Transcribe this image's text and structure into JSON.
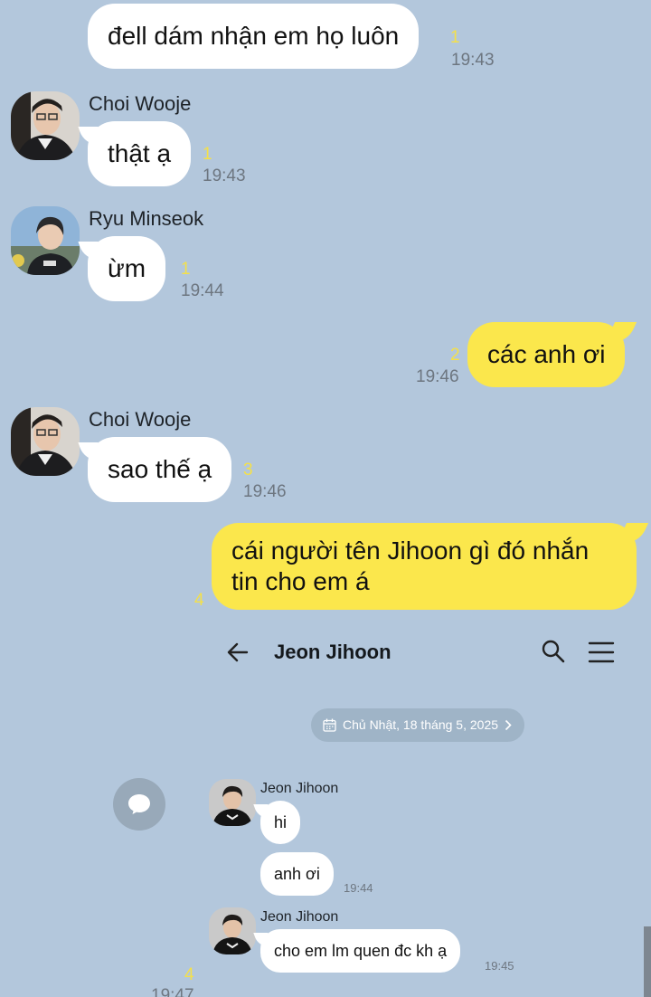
{
  "colors": {
    "background": "#b3c7dc",
    "my_bubble": "#fbe74c",
    "their_bubble": "#ffffff",
    "unread_count": "#f4e04a",
    "timestamp": "#6d7680"
  },
  "messages": [
    {
      "text": "đell dám nhận em họ luôn",
      "unread": "1",
      "time": "19:43"
    },
    {
      "sender": "Choi Wooje",
      "text": "thật ạ",
      "unread": "1",
      "time": "19:43"
    },
    {
      "sender": "Ryu Minseok",
      "text": "ừm",
      "unread": "1",
      "time": "19:44"
    },
    {
      "text": "các anh ơi",
      "unread": "2",
      "time": "19:46"
    },
    {
      "sender": "Choi Wooje",
      "text": "sao thế ạ",
      "unread": "3",
      "time": "19:46"
    },
    {
      "text_line1": "cái người tên Jihoon gì đó nhắn",
      "text_line2": "tin cho em á",
      "unread": "4"
    }
  ],
  "embedded_screenshot": {
    "title": "Jeon Jihoon",
    "back_icon": "arrow-left-icon",
    "search_icon": "search-icon",
    "menu_icon": "hamburger-menu-icon",
    "date_label": "Chủ Nhật, 18 tháng 5, 2025",
    "messages": [
      {
        "sender": "Jeon Jihoon",
        "text": "hi"
      },
      {
        "text": "anh ơi",
        "time": "19:44"
      },
      {
        "sender": "Jeon Jihoon",
        "text": "cho em lm quen đc kh ạ",
        "time": "19:45"
      }
    ],
    "unread": "4",
    "time": "19:47"
  },
  "floating_button_icon": "chat-bubble-icon"
}
